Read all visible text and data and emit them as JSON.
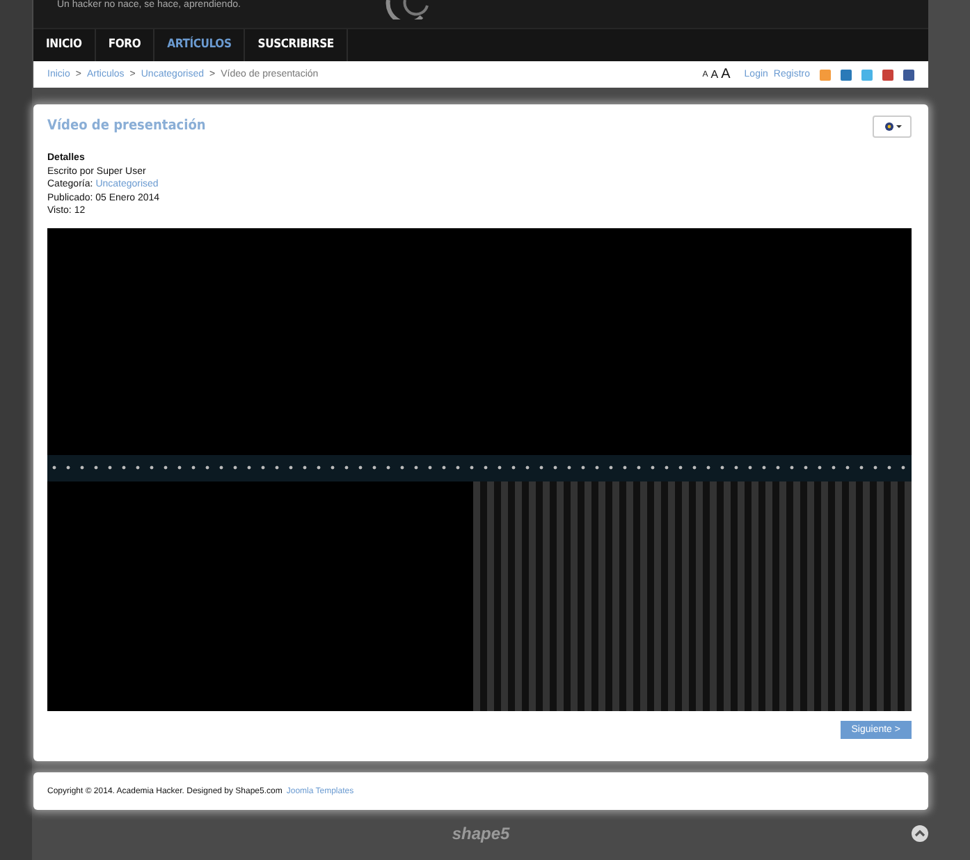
{
  "header": {
    "tagline": "Un hacker no nace, se hace, aprendiendo."
  },
  "nav": [
    {
      "label": "INICIO",
      "selected": false
    },
    {
      "label": "FORO",
      "selected": false
    },
    {
      "label": "ARTÍCULOS",
      "selected": true
    },
    {
      "label": "SUSCRIBIRSE",
      "selected": false
    }
  ],
  "breadcrumb": [
    {
      "label": "Inicio",
      "link": true
    },
    {
      "label": "Articulos",
      "link": true
    },
    {
      "label": "Uncategorised",
      "link": true
    },
    {
      "label": "Vídeo de presentación",
      "link": false
    }
  ],
  "breadcrumb_separator": ">",
  "font_sizes": [
    "A",
    "A",
    "A"
  ],
  "user_links": [
    "Login",
    "Registro"
  ],
  "article": {
    "title": "Vídeo de presentación",
    "details_heading": "Detalles",
    "author": "Escrito por Super User",
    "category_label": "Categoría:",
    "category": "Uncategorised",
    "published": "Publicado: 05 Enero 2014",
    "hits": "Visto: 12",
    "next_button": "Siguiente >"
  },
  "footer": {
    "copyright": "Copyright © 2014. Academia Hacker.  Designed by Shape5.com",
    "link": "Joomla Templates"
  },
  "bottom_logo": "shape5"
}
